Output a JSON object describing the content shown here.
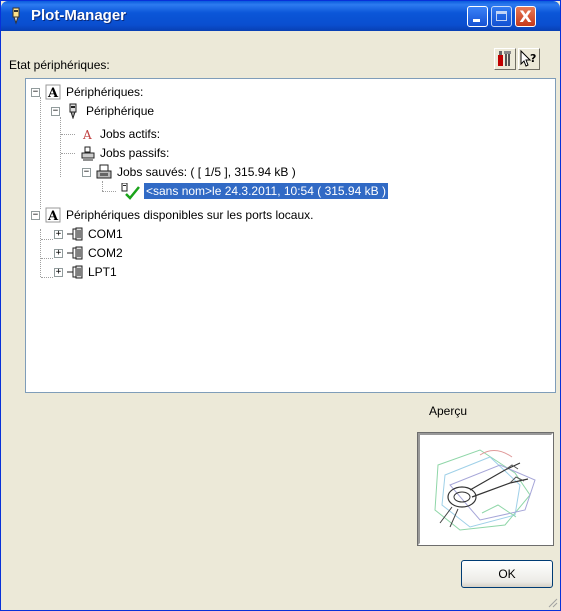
{
  "window": {
    "title": "Plot-Manager",
    "accent": "#0a4ecf",
    "controls": {
      "close_glyph": "X"
    }
  },
  "toolbar": {
    "status_label": "Etat périphériques:",
    "settings_icon": "tools-icon",
    "help_icon": "context-help-icon"
  },
  "tree": {
    "selected_color": "#316ac5",
    "items": [
      {
        "label": "Périphériques:",
        "icon": "font-a-icon",
        "expander": "−"
      },
      {
        "label": "Périphérique",
        "icon": "plotter-icon",
        "expander": "−"
      },
      {
        "label": "Jobs actifs:",
        "icon": "plot-a-icon"
      },
      {
        "label": "Jobs passifs:",
        "icon": "printer-tray-icon"
      },
      {
        "label": "Jobs sauvés: ( [ 1/5 ], 315.94 kB )",
        "icon": "saved-jobs-icon",
        "expander": "−"
      },
      {
        "label": "<sans nom>le 24.3.2011, 10:54 ( 315.94 kB )",
        "icon": "job-done-icon",
        "selected": true
      },
      {
        "label": "Périphériques disponibles sur les ports locaux.",
        "icon": "font-a-icon",
        "expander": "−"
      },
      {
        "label": "COM1",
        "icon": "port-connector-icon",
        "expander": "+"
      },
      {
        "label": "COM2",
        "icon": "port-connector-icon",
        "expander": "+"
      },
      {
        "label": "LPT1",
        "icon": "port-connector-icon",
        "expander": "+"
      }
    ]
  },
  "preview": {
    "label": "Aperçu",
    "image": "plot-preview-image"
  },
  "buttons": {
    "ok": "OK"
  }
}
